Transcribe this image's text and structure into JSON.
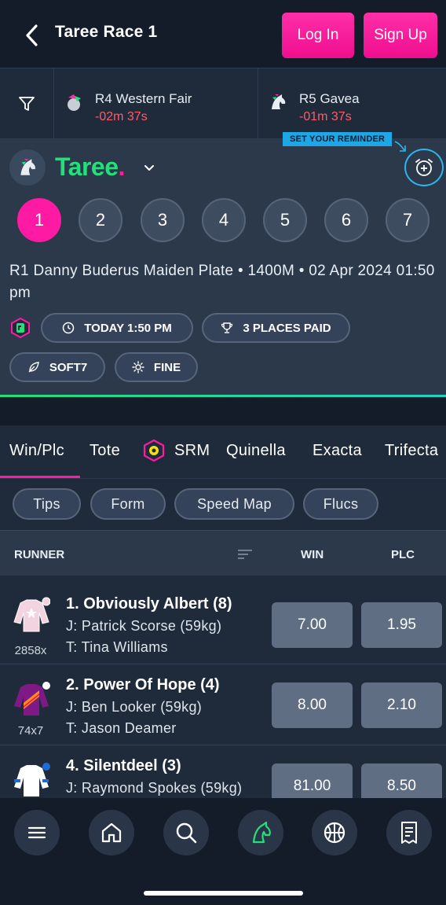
{
  "header": {
    "title": "Taree Race 1",
    "login_label": "Log In",
    "signup_label": "Sign Up"
  },
  "next_races": [
    {
      "name": "R4 Western Fair",
      "countdown": "-02m 37s"
    },
    {
      "name": "R5 Gavea",
      "countdown": "-01m 37s"
    }
  ],
  "venue": {
    "name": "Taree",
    "dot": ".",
    "reminder_label": "SET YOUR REMINDER"
  },
  "race_numbers": [
    "1",
    "2",
    "3",
    "4",
    "5",
    "6",
    "7"
  ],
  "active_race": "1",
  "race_info": {
    "description": "R1 Danny Buderus Maiden Plate • 1400M • 02 Apr 2024 01:50 pm",
    "time_chip": "TODAY 1:50 PM",
    "places_chip": "3 PLACES PAID",
    "track_chip": "SOFT7",
    "weather_chip": "FINE"
  },
  "bet_tabs": [
    "Win/Plc",
    "Tote",
    "SRM",
    "Quinella",
    "Exacta",
    "Trifecta"
  ],
  "active_tab": "Win/Plc",
  "sub_filters": [
    "Tips",
    "Form",
    "Speed Map",
    "Flucs"
  ],
  "table": {
    "col_runner": "RUNNER",
    "col_win": "WIN",
    "col_plc": "PLC"
  },
  "runners": [
    {
      "name": "1. Obviously Albert (8)",
      "jockey": "J: Patrick Scorse (59kg)",
      "trainer": "T: Tina Williams",
      "form": "2858x",
      "win": "7.00",
      "plc": "1.95"
    },
    {
      "name": "2. Power Of Hope (4)",
      "jockey": "J: Ben Looker (59kg)",
      "trainer": "T: Jason Deamer",
      "form": "74x7",
      "win": "8.00",
      "plc": "2.10"
    },
    {
      "name": "4. Silentdeel (3)",
      "jockey": "J: Raymond Spokes (59kg)",
      "trainer": "",
      "form": "",
      "win": "81.00",
      "plc": "8.50"
    }
  ],
  "colors": {
    "accent_pink": "#ff1aa3",
    "accent_green": "#22e07a",
    "negative_red": "#ff5b6b",
    "reminder_blue": "#1ea7e6"
  },
  "bottom_nav": [
    "menu-icon",
    "home-icon",
    "search-icon",
    "horse-racing-icon",
    "basketball-icon",
    "betslip-icon"
  ]
}
